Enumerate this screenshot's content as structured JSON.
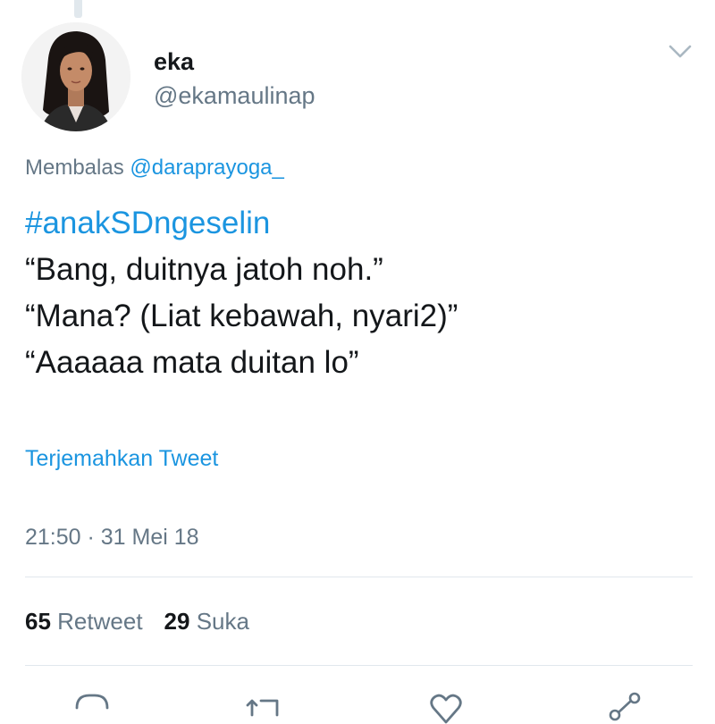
{
  "author": {
    "display_name": "eka",
    "handle": "@ekamaulinap"
  },
  "reply": {
    "prefix": "Membalas",
    "mention": "@daraprayoga_"
  },
  "tweet": {
    "hashtag": "#anakSDngeselin",
    "lines": [
      "“Bang, duitnya jatoh noh.”",
      "“Mana? (Liat kebawah, nyari2)”",
      "“Aaaaaa mata duitan lo”"
    ]
  },
  "translate_label": "Terjemahkan Tweet",
  "timestamp": "21:50 · 31 Mei 18",
  "stats": {
    "retweet_count": "65",
    "retweet_label": "Retweet",
    "like_count": "29",
    "like_label": "Suka"
  },
  "icons": {
    "menu": "chevron-down-icon",
    "reply": "reply-icon",
    "retweet": "retweet-icon",
    "like": "heart-icon",
    "share": "share-icon"
  },
  "colors": {
    "link": "#1b95e0",
    "secondary_text": "#657786",
    "primary_text": "#14171a",
    "divider": "#e1e8ed"
  }
}
